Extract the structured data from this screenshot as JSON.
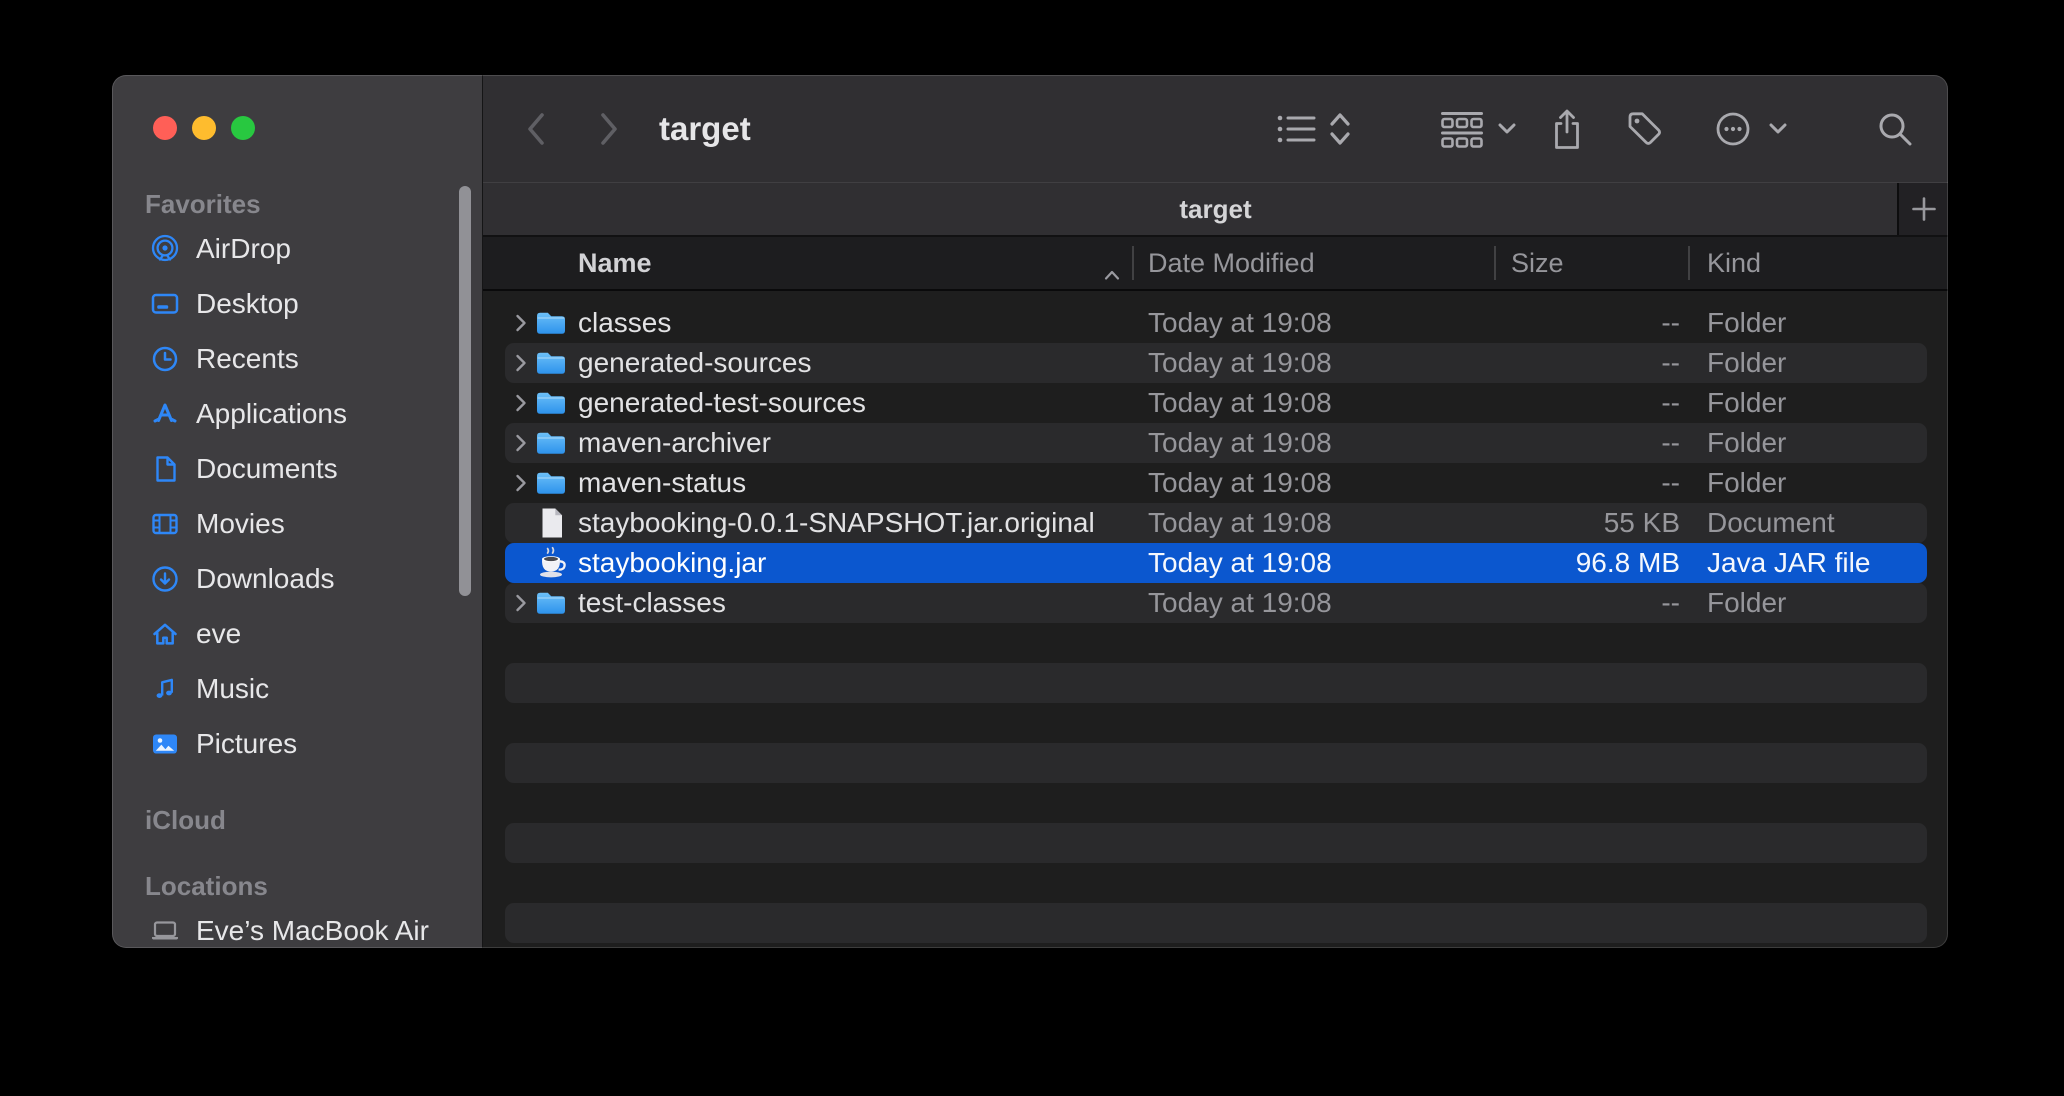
{
  "window": {
    "traffic_lights": [
      {
        "name": "close",
        "color": "#ff5f57"
      },
      {
        "name": "minimize",
        "color": "#febc2e"
      },
      {
        "name": "zoom",
        "color": "#28c840"
      }
    ]
  },
  "toolbar": {
    "title": "target",
    "icons": [
      "back",
      "forward",
      "list-view",
      "sort-direction",
      "group-by",
      "share",
      "tag",
      "more",
      "search"
    ]
  },
  "tab_bar": {
    "active_tab": "target",
    "new_tab_label": "+"
  },
  "sidebar": {
    "sections": [
      {
        "label": "Favorites",
        "items": [
          {
            "label": "AirDrop",
            "icon": "airdrop"
          },
          {
            "label": "Desktop",
            "icon": "desktop"
          },
          {
            "label": "Recents",
            "icon": "recents"
          },
          {
            "label": "Applications",
            "icon": "applications"
          },
          {
            "label": "Documents",
            "icon": "documents"
          },
          {
            "label": "Movies",
            "icon": "movies"
          },
          {
            "label": "Downloads",
            "icon": "downloads"
          },
          {
            "label": "eve",
            "icon": "home"
          },
          {
            "label": "Music",
            "icon": "music"
          },
          {
            "label": "Pictures",
            "icon": "pictures"
          }
        ]
      },
      {
        "label": "iCloud",
        "items": []
      },
      {
        "label": "Locations",
        "items": [
          {
            "label": "Eve’s MacBook Air",
            "icon": "laptop"
          }
        ]
      }
    ]
  },
  "list": {
    "columns": [
      {
        "label": "Name",
        "sort": "ascending"
      },
      {
        "label": "Date Modified"
      },
      {
        "label": "Size"
      },
      {
        "label": "Kind"
      }
    ],
    "rows": [
      {
        "name": "classes",
        "icon": "folder",
        "expandable": true,
        "date": "Today at 19:08",
        "size": "--",
        "kind": "Folder",
        "selected": false
      },
      {
        "name": "generated-sources",
        "icon": "folder",
        "expandable": true,
        "date": "Today at 19:08",
        "size": "--",
        "kind": "Folder",
        "selected": false
      },
      {
        "name": "generated-test-sources",
        "icon": "folder",
        "expandable": true,
        "date": "Today at 19:08",
        "size": "--",
        "kind": "Folder",
        "selected": false
      },
      {
        "name": "maven-archiver",
        "icon": "folder",
        "expandable": true,
        "date": "Today at 19:08",
        "size": "--",
        "kind": "Folder",
        "selected": false
      },
      {
        "name": "maven-status",
        "icon": "folder",
        "expandable": true,
        "date": "Today at 19:08",
        "size": "--",
        "kind": "Folder",
        "selected": false
      },
      {
        "name": "staybooking-0.0.1-SNAPSHOT.jar.original",
        "icon": "document",
        "expandable": false,
        "date": "Today at 19:08",
        "size": "55 KB",
        "kind": "Document",
        "selected": false
      },
      {
        "name": "staybooking.jar",
        "icon": "jar",
        "expandable": false,
        "date": "Today at 19:08",
        "size": "96.8 MB",
        "kind": "Java JAR file",
        "selected": true
      },
      {
        "name": "test-classes",
        "icon": "folder",
        "expandable": true,
        "date": "Today at 19:08",
        "size": "--",
        "kind": "Folder",
        "selected": false
      }
    ]
  },
  "colors": {
    "selection_blue": "#0b57cf",
    "sidebar_icon_blue": "#2e87f7",
    "folder_blue": "#3ba0f2",
    "sidebar_bg": "#3e3d40",
    "toolbar_bg": "#302f32",
    "list_bg": "#1e1e1e",
    "stripe_bg": "#2a2a2c"
  }
}
